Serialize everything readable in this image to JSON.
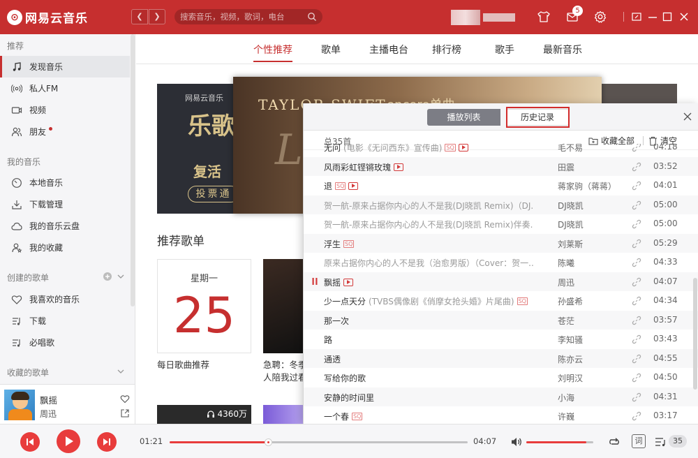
{
  "app": {
    "logo_text": "网易云音乐"
  },
  "search": {
    "placeholder": "搜索音乐，视频，歌词，电台"
  },
  "header": {
    "mail_badge": "5"
  },
  "sidebar": {
    "section_recommend": "推荐",
    "recommend_items": [
      {
        "label": "发现音乐",
        "icon": "music-note-icon"
      },
      {
        "label": "私人FM",
        "icon": "radio-icon"
      },
      {
        "label": "视频",
        "icon": "video-icon"
      },
      {
        "label": "朋友",
        "icon": "friends-icon"
      }
    ],
    "section_my_music": "我的音乐",
    "my_music_items": [
      {
        "label": "本地音乐",
        "icon": "local-music-icon"
      },
      {
        "label": "下载管理",
        "icon": "download-icon"
      },
      {
        "label": "我的音乐云盘",
        "icon": "cloud-icon"
      },
      {
        "label": "我的收藏",
        "icon": "collection-icon"
      }
    ],
    "section_created": "创建的歌单",
    "created_items": [
      {
        "label": "我喜欢的音乐",
        "icon": "heart-icon"
      },
      {
        "label": "下载",
        "icon": "playlist-icon"
      },
      {
        "label": "必唱歌",
        "icon": "playlist-icon"
      }
    ],
    "section_collected": "收藏的歌单"
  },
  "now_playing": {
    "title": "飘摇",
    "artist": "周迅"
  },
  "tabs": [
    "个性推荐",
    "歌单",
    "主播电台",
    "排行榜",
    "歌手",
    "最新音乐"
  ],
  "banner": {
    "left_logo": "网易云音乐",
    "left_big": "乐歌",
    "left_sub": "复活",
    "left_button": "投票通",
    "main_title": "TAYLOR SWIFT",
    "main_cn": "encore单曲"
  },
  "recommend": {
    "title": "推荐歌单",
    "day_card_week": "星期一",
    "day_card_number": "25",
    "day_card_label": "每日歌曲推荐",
    "card2_label_line1": "急聘：冬季",
    "card2_label_line2": "人陪我过看",
    "card3_count": "4360万"
  },
  "popup": {
    "tab_playlist": "播放列表",
    "tab_history": "历史记录",
    "total": "总35首",
    "collect_all": "收藏全部",
    "clear": "清空",
    "songs": [
      {
        "title": "无问",
        "sub": "(电影《无问西东》宣传曲)",
        "tags": [
          "sq",
          "mv"
        ],
        "artist": "毛不易",
        "duration": "04:18",
        "grey": false,
        "playing": false
      },
      {
        "title": "风雨彩虹铿锵玫瑰",
        "sub": "",
        "tags": [
          "mv"
        ],
        "artist": "田震",
        "duration": "03:52",
        "grey": false,
        "playing": false
      },
      {
        "title": "退",
        "sub": "",
        "tags": [
          "sq",
          "mv"
        ],
        "artist": "蒋家驹（蒋蒋）",
        "duration": "04:01",
        "grey": false,
        "playing": false
      },
      {
        "title": "贺一航-原来占据你内心的人不是我(DJ晓凯 Remix)（DJ...",
        "sub": "",
        "tags": [
          "sq"
        ],
        "artist": "DJ晓凯",
        "duration": "05:00",
        "grey": true,
        "playing": false
      },
      {
        "title": "贺一航-原来占据你内心的人不是我(DJ晓凯 Remix)伴奏...",
        "sub": "",
        "tags": [
          "sq"
        ],
        "artist": "DJ晓凯",
        "duration": "05:00",
        "grey": true,
        "playing": false
      },
      {
        "title": "浮生",
        "sub": "",
        "tags": [
          "sq"
        ],
        "artist": "刘莱斯",
        "duration": "05:29",
        "grey": false,
        "playing": false
      },
      {
        "title": "原来占据你内心的人不是我（治愈男版）（Cover：贺一...",
        "sub": "",
        "tags": [
          "sq"
        ],
        "artist": "陈曦",
        "duration": "04:33",
        "grey": true,
        "playing": false
      },
      {
        "title": "飘摇",
        "sub": "",
        "tags": [
          "mv"
        ],
        "artist": "周迅",
        "duration": "04:07",
        "grey": false,
        "playing": true
      },
      {
        "title": "少一点天分",
        "sub": "(TVBS偶像剧《俏摩女抢头婚》片尾曲)",
        "tags": [
          "sq"
        ],
        "artist": "孙盛希",
        "duration": "04:34",
        "grey": false,
        "playing": false
      },
      {
        "title": "那一次",
        "sub": "",
        "tags": [],
        "artist": "苍茫",
        "duration": "03:57",
        "grey": false,
        "playing": false
      },
      {
        "title": "路",
        "sub": "",
        "tags": [],
        "artist": "李知骚",
        "duration": "03:43",
        "grey": false,
        "playing": false
      },
      {
        "title": "通透",
        "sub": "",
        "tags": [],
        "artist": "陈亦云",
        "duration": "04:55",
        "grey": false,
        "playing": false
      },
      {
        "title": "写给你的歌",
        "sub": "",
        "tags": [],
        "artist": "刘明汉",
        "duration": "04:50",
        "grey": false,
        "playing": false
      },
      {
        "title": "安静的时间里",
        "sub": "",
        "tags": [],
        "artist": "小海",
        "duration": "04:31",
        "grey": false,
        "playing": false
      },
      {
        "title": "一个春",
        "sub": "",
        "tags": [
          "sq"
        ],
        "artist": "许巍",
        "duration": "03:17",
        "grey": false,
        "playing": false
      }
    ]
  },
  "player": {
    "current_time": "01:21",
    "total_time": "04:07",
    "progress": 0.33,
    "volume": 0.9,
    "lyric_label": "词",
    "playlist_count": "35"
  },
  "colors": {
    "brand_red": "#c62f2f",
    "accent_red": "#e83c3c"
  }
}
